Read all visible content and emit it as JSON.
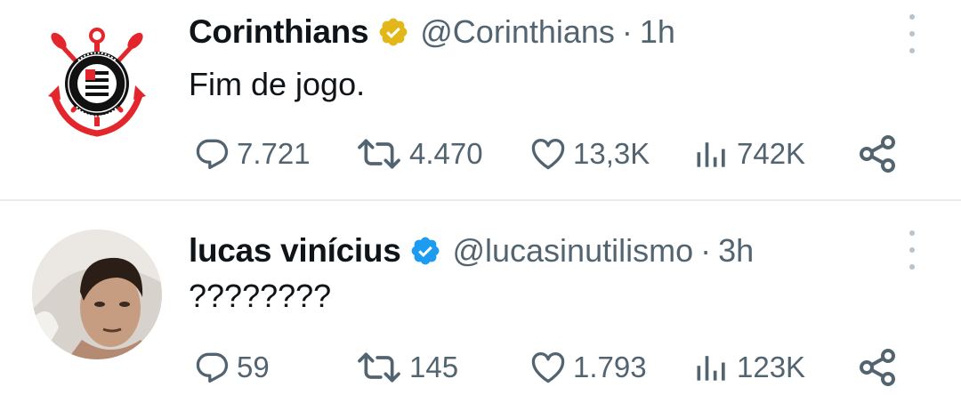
{
  "tweets": [
    {
      "name": "Corinthians",
      "handle": "@Corinthians",
      "separator": "·",
      "time": "1h",
      "text": "Fim de jogo.",
      "verified": "gold-check-badge",
      "avatar": "corinthians-crest",
      "replies": "7.721",
      "retweets": "4.470",
      "likes": "13,3K",
      "views": "742K"
    },
    {
      "name": "lucas vinícius",
      "handle": "@lucasinutilismo",
      "separator": "·",
      "time": "3h",
      "text": "????????",
      "verified": "blue-check-badge",
      "avatar": "profile-photo",
      "replies": "59",
      "retweets": "145",
      "likes": "1.793",
      "views": "123K"
    }
  ],
  "colors": {
    "text": "#0f1419",
    "secondary": "#536471",
    "gold": "#e2b719",
    "blue": "#1d9bf0",
    "corinthians_red": "#e3262c"
  }
}
